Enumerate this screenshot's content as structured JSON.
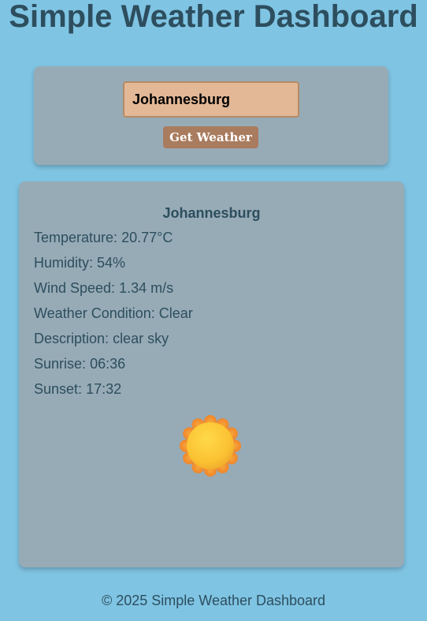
{
  "header": {
    "title": "Simple Weather Dashboard"
  },
  "search": {
    "value": "Johannesburg",
    "button_label": "Get Weather"
  },
  "weather": {
    "city": "Johannesburg",
    "details": [
      {
        "label": "Temperature:",
        "value": "20.77°C"
      },
      {
        "label": "Humidity:",
        "value": "54%"
      },
      {
        "label": "Wind Speed:",
        "value": "1.34 m/s"
      },
      {
        "label": "Weather Condition:",
        "value": "Clear"
      },
      {
        "label": "Description:",
        "value": "clear sky"
      },
      {
        "label": "Sunrise:",
        "value": "06:36"
      },
      {
        "label": "Sunset:",
        "value": "17:32"
      }
    ],
    "icon": "sun-icon"
  },
  "footer": {
    "text": "© 2025 Simple Weather Dashboard"
  },
  "colors": {
    "background": "#7fc4e3",
    "card": "#97abb6",
    "input": "#e3b897",
    "button": "#a97c5f",
    "text": "#2d4e5e",
    "sun_outer": "#f39a2e",
    "sun_inner": "#fcc73a"
  }
}
